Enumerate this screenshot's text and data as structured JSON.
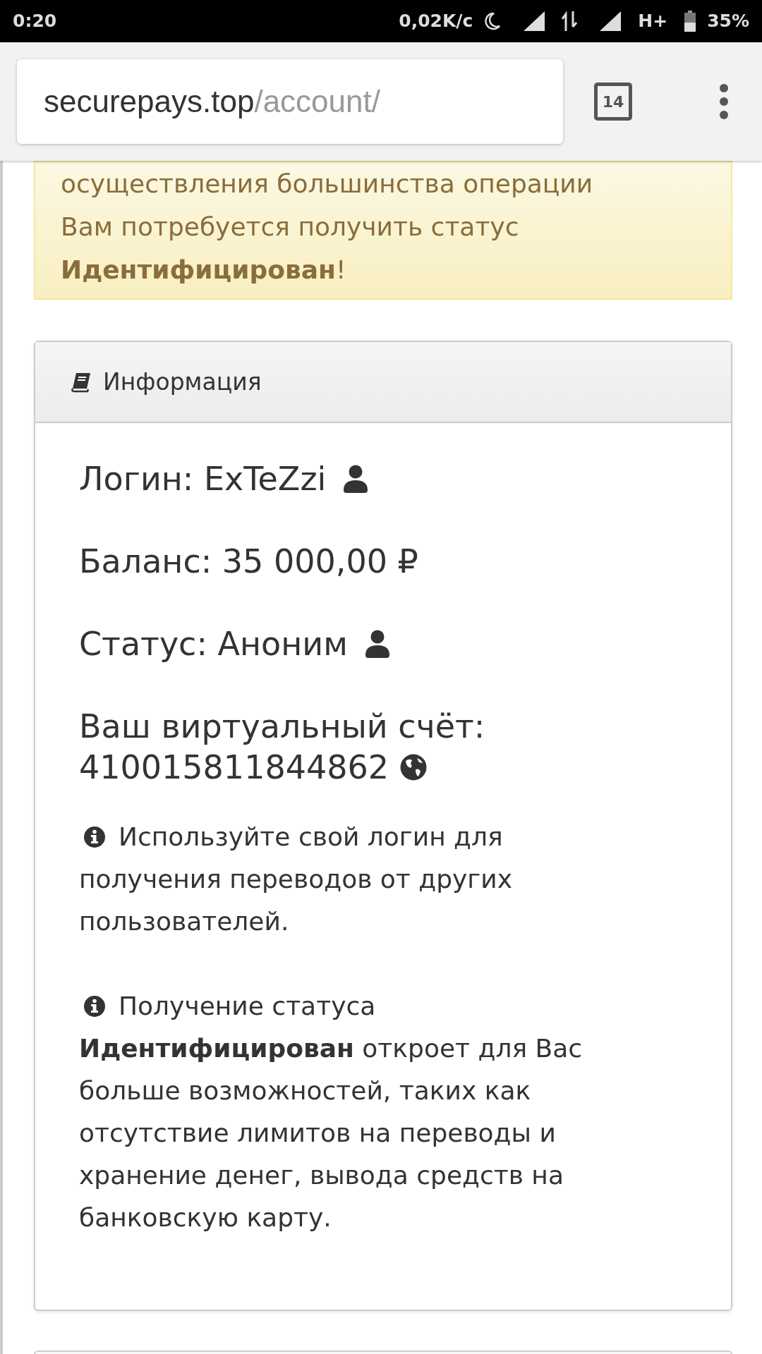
{
  "status_bar": {
    "time": "0:20",
    "net_speed": "0,02K/c",
    "network_type": "H+",
    "battery": "35%"
  },
  "browser": {
    "url_host": "securepays.top",
    "url_path": "/account/",
    "tab_count": "14"
  },
  "alert": {
    "text": "осуществления большинства операции Вам потребуется получить статус **Идентифицирован**!"
  },
  "card": {
    "title": "Информация",
    "fields": [
      {
        "kind": "user",
        "text": "Логин: ExTeZzi"
      },
      {
        "kind": "plain",
        "text": "Баланс: 35 000,00 ₽"
      },
      {
        "kind": "user",
        "text": "Статус: Аноним"
      },
      {
        "kind": "globe",
        "label": "Ваш виртуальный счёт:",
        "text": "410015811844862"
      }
    ],
    "notes": [
      {
        "first_line": "Используйте свой логин для",
        "rest": "получения переводов от других пользователей."
      },
      {
        "first_line": "Получение статуса",
        "rest": "**Идентифицирован** откроет для Вас больше возможностей, таких как отсутствие лимитов на переводы и хранение денег, вывода средств на банковскую карту."
      }
    ]
  }
}
